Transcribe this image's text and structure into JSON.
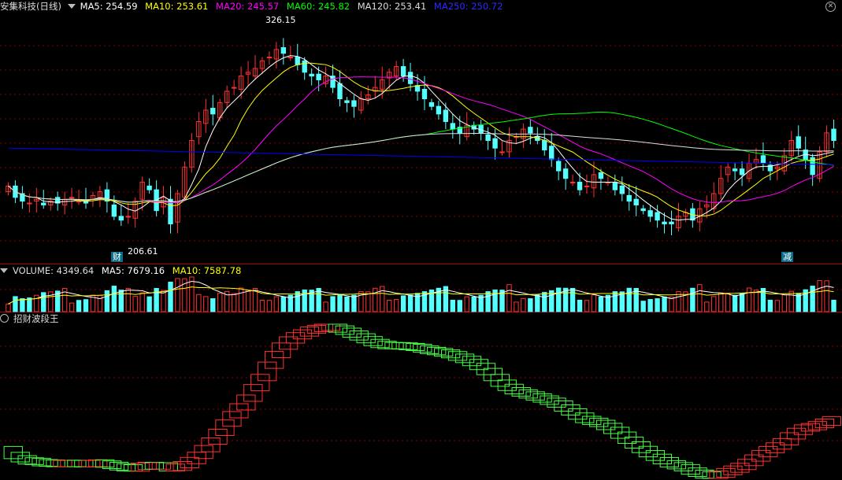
{
  "price_panel": {
    "title": "安集科技(日线)",
    "ma5": "MA5: 254.59",
    "ma10": "MA10: 253.61",
    "ma20": "MA20: 245.57",
    "ma60": "MA60: 245.82",
    "ma120": "MA120: 253.41",
    "ma250": "MA250: 250.72",
    "high_label": "326.15",
    "low_label": "206.61",
    "marker_cai": "财",
    "marker_jian": "减"
  },
  "volume_panel": {
    "volume": "VOLUME: 4349.64",
    "ma5": "MA5: 7679.16",
    "ma10": "MA10: 7587.78"
  },
  "indicator_panel": {
    "title": "招财波段王"
  },
  "colors": {
    "up": "#ff3232",
    "down": "#54ffff",
    "ma5": "#ffffff",
    "ma10": "#ffff00",
    "ma20": "#ff00ff",
    "ma60": "#00ff00",
    "ma120": "#dddddd",
    "ma250": "#0000ff",
    "grid": "#8b0000"
  },
  "chart_data": {
    "type": "candlestick",
    "price_range": [
      206.61,
      326.15
    ],
    "closes": [
      238,
      232,
      230,
      229,
      231,
      228,
      230,
      229,
      231,
      232,
      230,
      229,
      233,
      235,
      230,
      222,
      220,
      222,
      230,
      240,
      236,
      225,
      232,
      218,
      234,
      248,
      262,
      272,
      278,
      276,
      282,
      288,
      290,
      296,
      298,
      300,
      304,
      306,
      310,
      308,
      306,
      302,
      298,
      296,
      294,
      296,
      290,
      284,
      282,
      280,
      284,
      286,
      290,
      294,
      298,
      301,
      296,
      292,
      288,
      284,
      280,
      276,
      272,
      268,
      266,
      270,
      268,
      266,
      262,
      258,
      256,
      262,
      264,
      268,
      266,
      262,
      257,
      252,
      246,
      242,
      240,
      236,
      238,
      244,
      242,
      240,
      236,
      234,
      230,
      228,
      225,
      222,
      220,
      218,
      218,
      222,
      224,
      220,
      226,
      228,
      234,
      242,
      248,
      246,
      244,
      250,
      252,
      250,
      246,
      248,
      254,
      262,
      258,
      252,
      244,
      256,
      266,
      262
    ],
    "volume_ma5_last": 7679.16,
    "volume_ma10_last": 7587.78,
    "volume_last": 4349.64
  }
}
